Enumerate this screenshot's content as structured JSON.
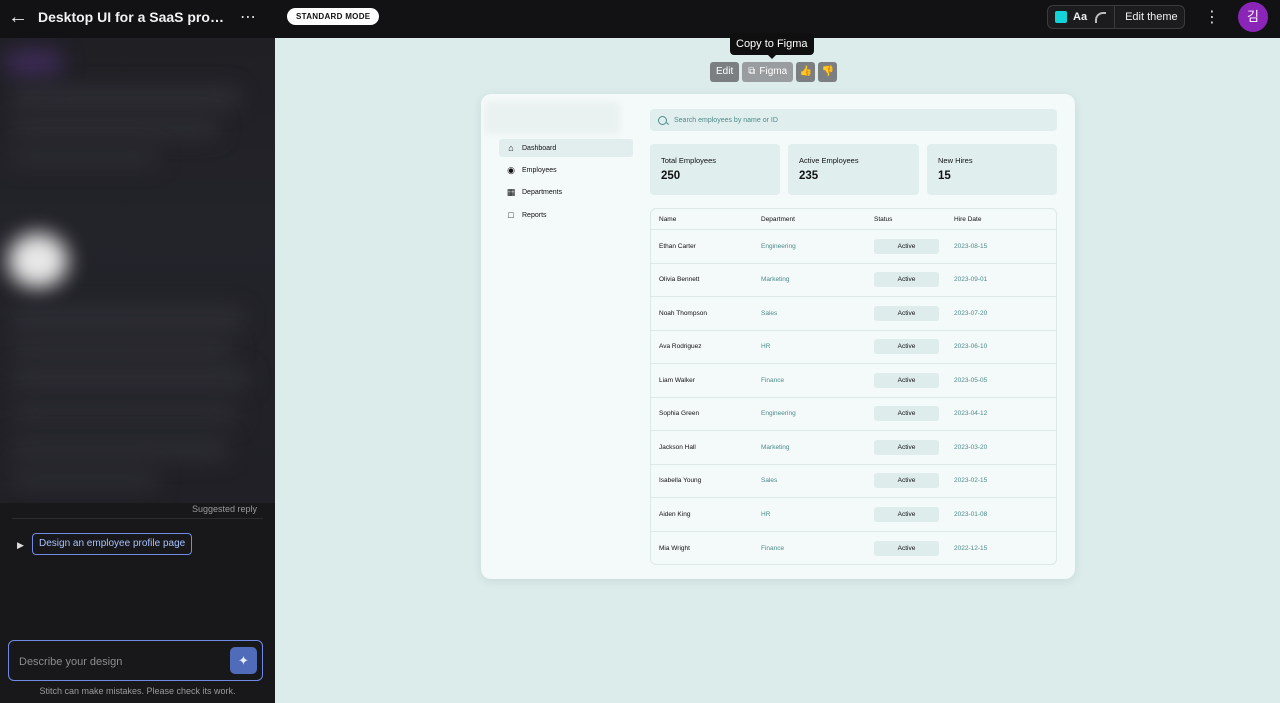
{
  "header": {
    "title": "Desktop UI for a SaaS program...",
    "mode_badge": "STANDARD MODE",
    "theme_font_label": "Aa",
    "edit_theme_label": "Edit theme",
    "avatar_initial": "김",
    "accent_swatch_color": "#14d3d8"
  },
  "chat": {
    "suggested_reply_label": "Suggested reply",
    "suggestion_chip": "Design an employee profile page",
    "prompt_placeholder": "Describe your design",
    "disclaimer": "Stitch can make mistakes. Please check its work."
  },
  "canvas": {
    "tooltip": "Copy to Figma",
    "toolbar": {
      "edit_label": "Edit",
      "figma_label": "Figma"
    }
  },
  "mock_app": {
    "search_placeholder": "Search employees by name or ID",
    "nav": [
      {
        "label": "Dashboard",
        "icon": "home-icon"
      },
      {
        "label": "Employees",
        "icon": "users-icon"
      },
      {
        "label": "Departments",
        "icon": "building-icon"
      },
      {
        "label": "Reports",
        "icon": "report-icon"
      }
    ],
    "stats": [
      {
        "label": "Total Employees",
        "value": "250"
      },
      {
        "label": "Active Employees",
        "value": "235"
      },
      {
        "label": "New Hires",
        "value": "15"
      }
    ],
    "table": {
      "columns": [
        "Name",
        "Department",
        "Status",
        "Hire Date"
      ],
      "rows": [
        {
          "name": "Ethan Carter",
          "department": "Engineering",
          "status": "Active",
          "hire_date": "2023-08-15"
        },
        {
          "name": "Olivia Bennett",
          "department": "Marketing",
          "status": "Active",
          "hire_date": "2023-09-01"
        },
        {
          "name": "Noah Thompson",
          "department": "Sales",
          "status": "Active",
          "hire_date": "2023-07-20"
        },
        {
          "name": "Ava Rodriguez",
          "department": "HR",
          "status": "Active",
          "hire_date": "2023-06-10"
        },
        {
          "name": "Liam Walker",
          "department": "Finance",
          "status": "Active",
          "hire_date": "2023-05-05"
        },
        {
          "name": "Sophia Green",
          "department": "Engineering",
          "status": "Active",
          "hire_date": "2023-04-12"
        },
        {
          "name": "Jackson Hall",
          "department": "Marketing",
          "status": "Active",
          "hire_date": "2023-03-20"
        },
        {
          "name": "Isabella Young",
          "department": "Sales",
          "status": "Active",
          "hire_date": "2023-02-15"
        },
        {
          "name": "Aiden King",
          "department": "HR",
          "status": "Active",
          "hire_date": "2023-01-08"
        },
        {
          "name": "Mia Wright",
          "department": "Finance",
          "status": "Active",
          "hire_date": "2022-12-15"
        }
      ]
    }
  }
}
